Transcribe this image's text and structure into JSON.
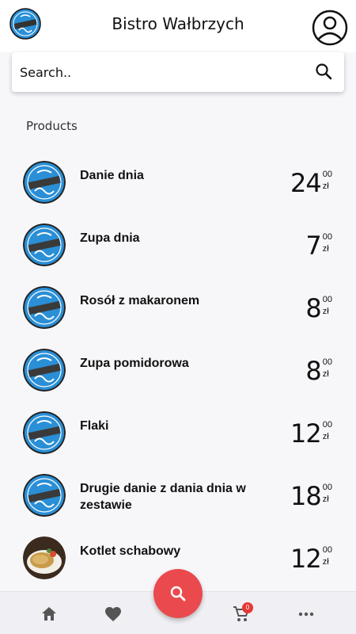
{
  "header": {
    "title": "Bistro Wałbrzych",
    "logo_icon": "bar-bistro-logo",
    "account_icon": "account-circle-icon"
  },
  "search": {
    "placeholder": "Search..",
    "icon": "search-icon"
  },
  "section_label": "Products",
  "products": [
    {
      "name": "Danie dnia",
      "price_int": "24",
      "price_cents": "00",
      "currency": "zł",
      "image": "bar-bistro-logo"
    },
    {
      "name": "Zupa dnia",
      "price_int": "7",
      "price_cents": "00",
      "currency": "zł",
      "image": "bar-bistro-logo"
    },
    {
      "name": "Rosół z makaronem",
      "price_int": "8",
      "price_cents": "00",
      "currency": "zł",
      "image": "bar-bistro-logo"
    },
    {
      "name": "Zupa pomidorowa",
      "price_int": "8",
      "price_cents": "00",
      "currency": "zł",
      "image": "bar-bistro-logo"
    },
    {
      "name": "Flaki",
      "price_int": "12",
      "price_cents": "00",
      "currency": "zł",
      "image": "bar-bistro-logo"
    },
    {
      "name": "Drugie danie z dania dnia w zestawie",
      "price_int": "18",
      "price_cents": "00",
      "currency": "zł",
      "image": "bar-bistro-logo"
    },
    {
      "name": "Kotlet schabowy",
      "price_int": "12",
      "price_cents": "00",
      "currency": "zł",
      "image": "food-photo"
    }
  ],
  "bottom_nav": {
    "items": [
      "home-icon",
      "heart-icon",
      "search-icon",
      "cart-icon",
      "more-icon"
    ],
    "cart_count": "0"
  },
  "colors": {
    "accent": "#ea4a4d",
    "logo_blue": "#2a8fd6",
    "badge": "#e53935"
  }
}
